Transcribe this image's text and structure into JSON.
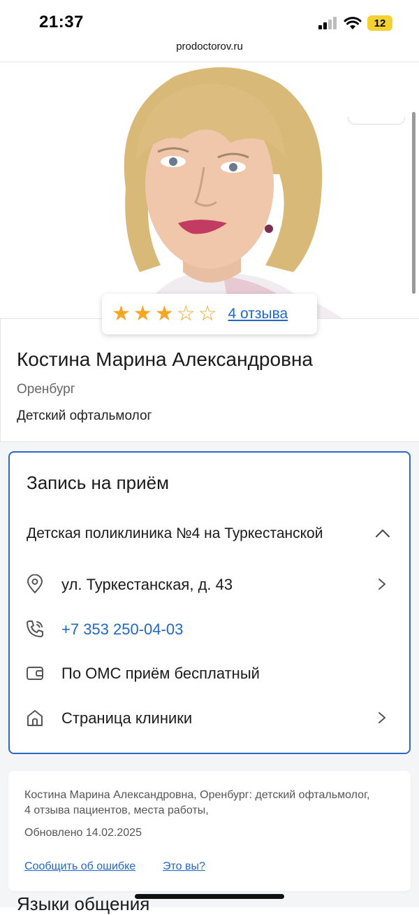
{
  "status_bar": {
    "time": "21:37",
    "battery": "12",
    "url": "prodoctorov.ru"
  },
  "rating": {
    "stars": 3,
    "max_stars": 5,
    "reviews_link": "4 отзыва"
  },
  "doctor": {
    "name": "Костина Марина Александровна",
    "city": "Оренбург",
    "specialty": "Детский офтальмолог"
  },
  "booking": {
    "title": "Запись на приём",
    "clinic": "Детская поликлиника №4 на Туркестанской",
    "rows": [
      {
        "icon": "location-pin-icon",
        "text": "ул. Туркестанская, д. 43",
        "chevron": true
      },
      {
        "icon": "phone-icon",
        "text": "+7 353 250-04-03",
        "chevron": false
      },
      {
        "icon": "wallet-icon",
        "text": "По ОМС приём бесплатный",
        "chevron": false
      },
      {
        "icon": "home-icon",
        "text": "Страница клиники",
        "chevron": true
      }
    ]
  },
  "meta": {
    "description": "Костина Марина Александровна, Оренбург: детский офтальмолог, 4 отзыва пациентов, места работы,",
    "updated": "Обновлено 14.02.2025",
    "report_error": "Сообщить об ошибке",
    "is_it_you": "Это вы?"
  },
  "next_section_title": "Языки общения",
  "colors": {
    "accent": "#2a69c4",
    "link": "#2167c7",
    "star": "#f5a623"
  }
}
